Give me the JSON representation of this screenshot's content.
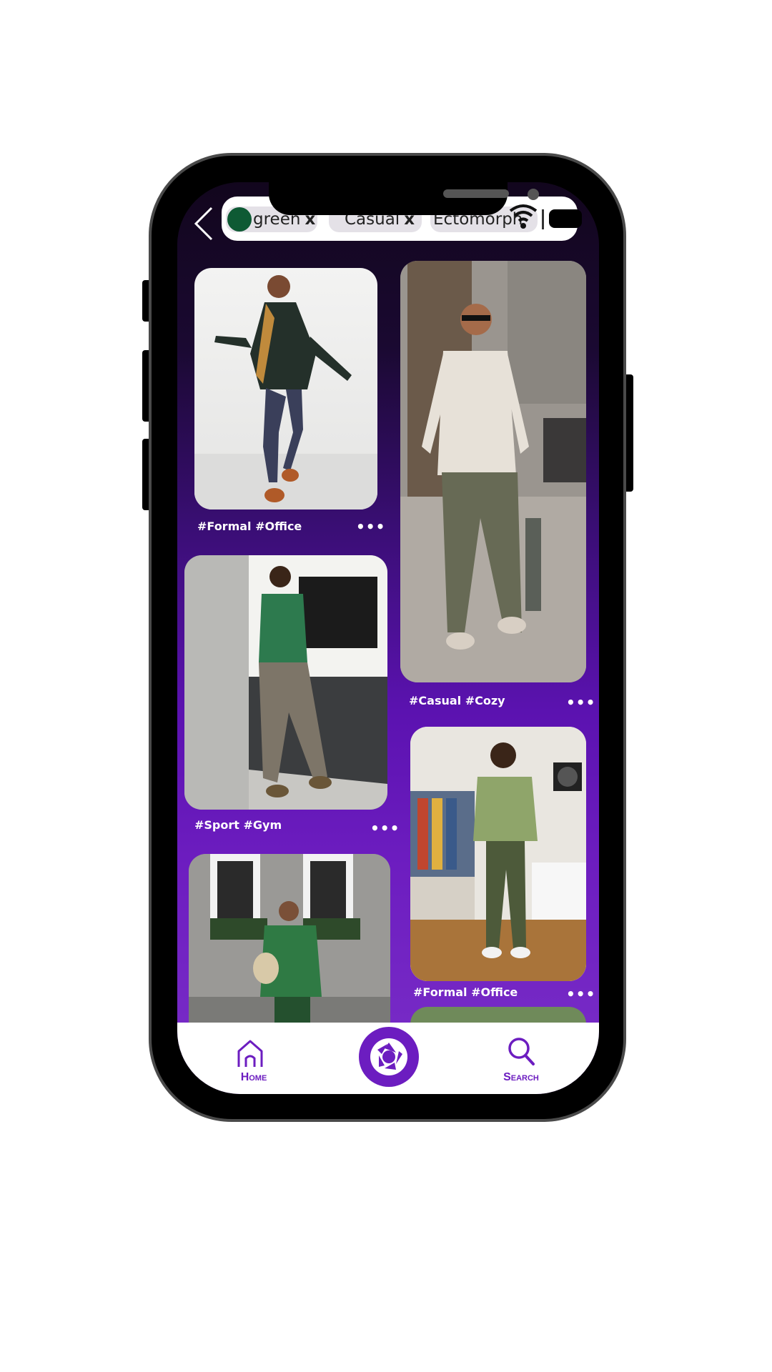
{
  "topbar": {
    "filters": [
      {
        "label": "green",
        "remove": "x",
        "swatch": "#0e5a34"
      },
      {
        "label": "Casual",
        "remove": "x"
      },
      {
        "label": "Ectomorph",
        "remove": ""
      }
    ]
  },
  "feed": {
    "cards": [
      {
        "caption": "#Formal #Office",
        "more": "•••"
      },
      {
        "caption": "#Casual #Cozy",
        "more": "•••"
      },
      {
        "caption": "#Sport #Gym",
        "more": "•••"
      },
      {
        "caption": "#Formal #Office",
        "more": "•••"
      }
    ]
  },
  "nav": {
    "home": "Home",
    "search": "Search",
    "accent": "#6c1dc0"
  }
}
